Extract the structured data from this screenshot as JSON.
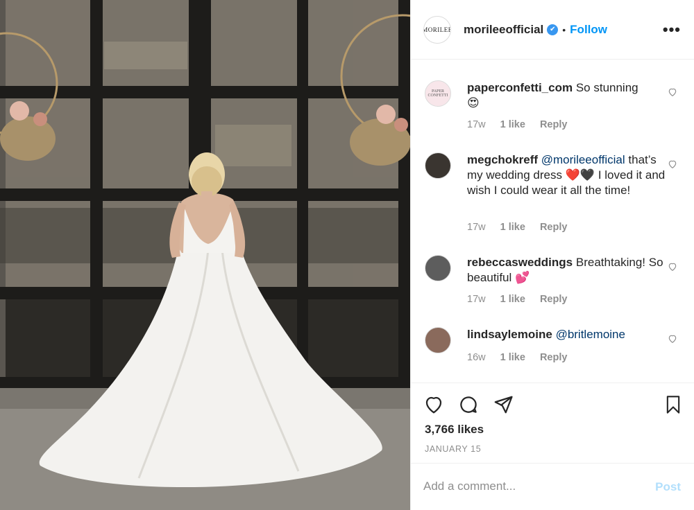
{
  "post": {
    "author": "morileeofficial",
    "author_avatar_text": "MORILEE",
    "verified_icon": "✔",
    "separator": "•",
    "follow_label": "Follow",
    "more_label": "•••",
    "likes": "3,766 likes",
    "date": "JANUARY 15"
  },
  "comments": [
    {
      "user": "paperconfetti_com",
      "avatar_text": "PAPER CONFETTI",
      "mention": "",
      "text": "So stunning",
      "emoji": "😍",
      "age": "17w",
      "likes": "1 like",
      "reply": "Reply"
    },
    {
      "user": "megchokreff",
      "mention": "@morileeofficial",
      "text": "that’s my wedding dress",
      "emoji": "❤️🖤",
      "text_after": "I loved it and wish I could wear it all the time!",
      "age": "17w",
      "likes": "1 like",
      "reply": "Reply"
    },
    {
      "user": "rebeccasweddings",
      "mention": "",
      "text": "Breathtaking! So beautiful",
      "emoji": "💕",
      "age": "17w",
      "likes": "1 like",
      "reply": "Reply"
    },
    {
      "user": "lindsaylemoine",
      "mention": "@britlemoine",
      "text": "",
      "age": "16w",
      "likes": "1 like",
      "reply": "Reply"
    }
  ],
  "add_comment": {
    "placeholder": "Add a comment...",
    "post_label": "Post"
  },
  "colors": {
    "link": "#0095f6",
    "mention": "#00376b",
    "muted": "#8e8e8e",
    "post_disabled": "#b2dffc"
  },
  "icons": [
    "heart-icon",
    "comment-icon",
    "share-icon",
    "bookmark-icon",
    "more-icon",
    "verified-icon"
  ]
}
